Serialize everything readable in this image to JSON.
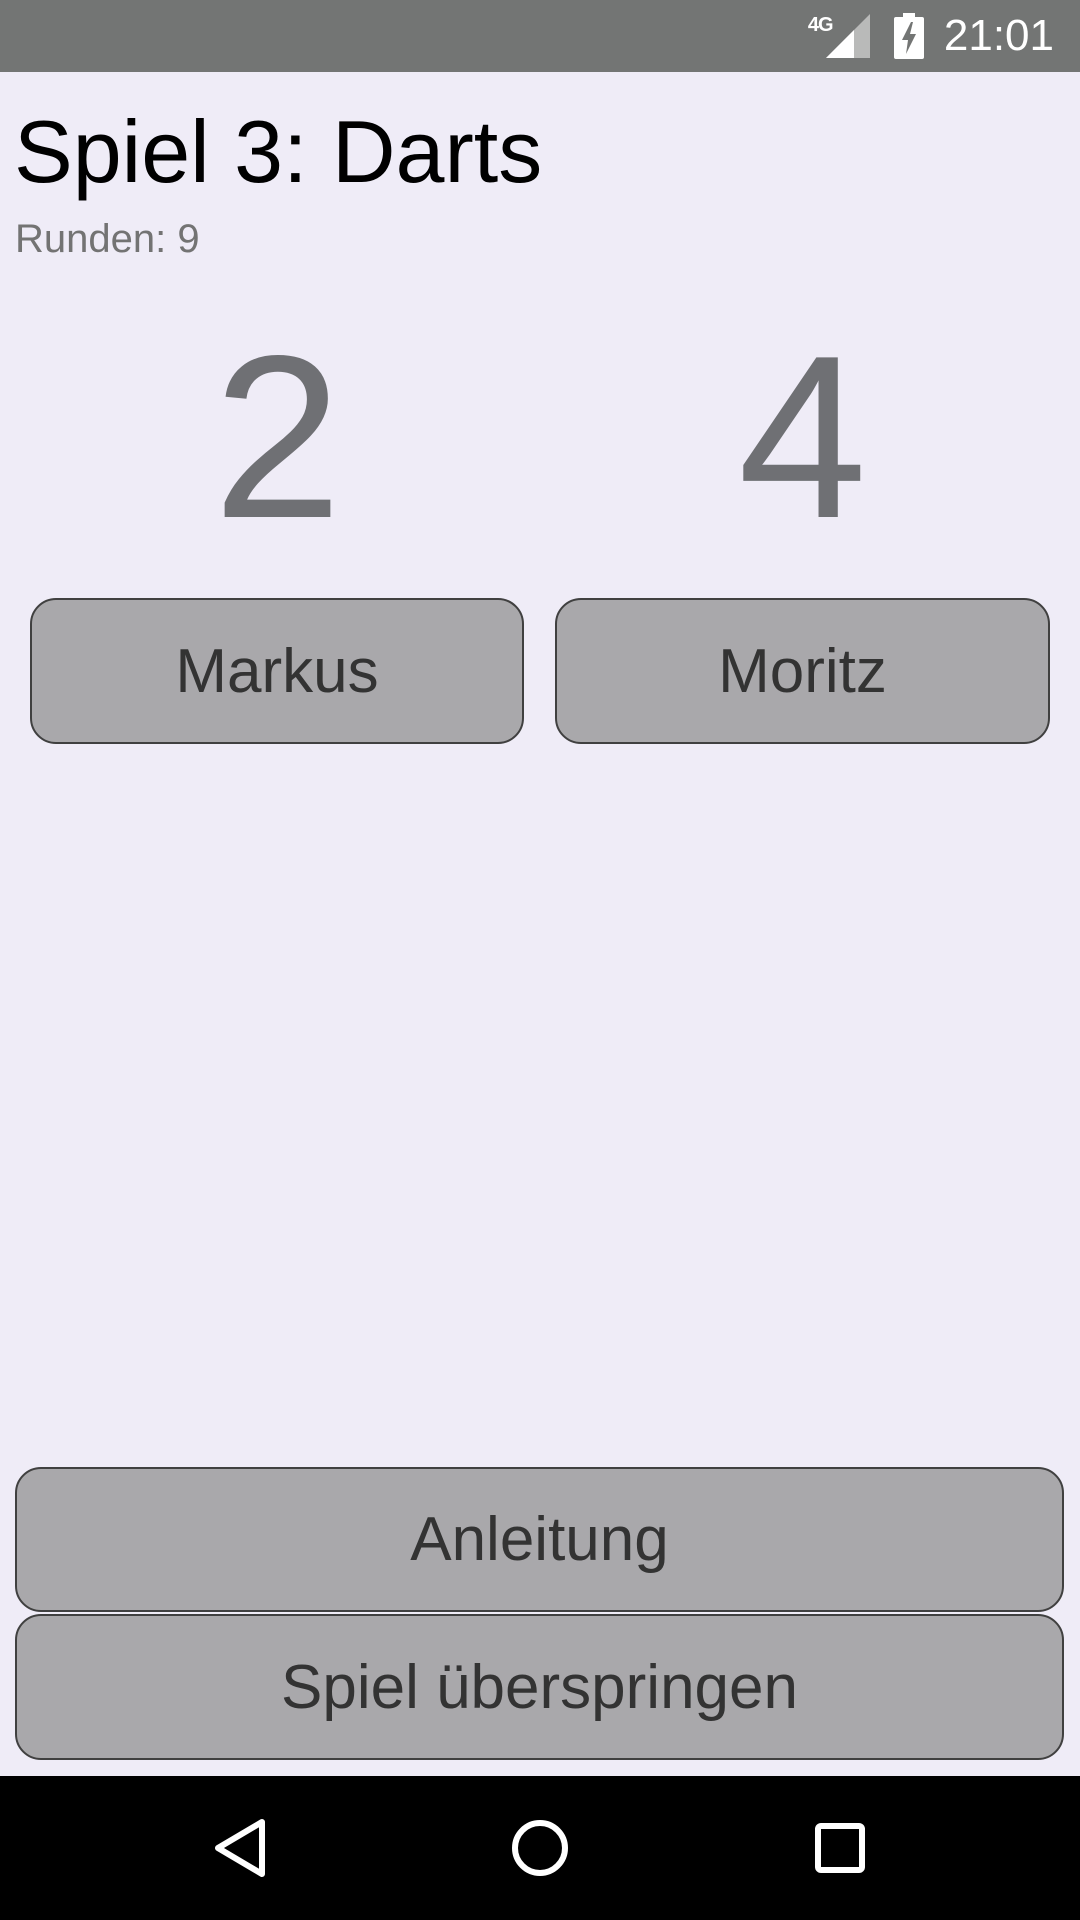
{
  "status_bar": {
    "network_label": "4G",
    "time": "21:01",
    "icons": [
      "signal-icon",
      "battery-charging-icon"
    ]
  },
  "game": {
    "title": "Spiel 3: Darts",
    "rounds_text": "Runden: 9"
  },
  "players": [
    {
      "name": "Markus",
      "score": "2"
    },
    {
      "name": "Moritz",
      "score": "4"
    }
  ],
  "actions": {
    "instructions_label": "Anleitung",
    "skip_label": "Spiel überspringen"
  },
  "nav_bar": {
    "icons": [
      "back-icon",
      "home-icon",
      "recent-apps-icon"
    ]
  },
  "colors": {
    "background": "#efecf7",
    "status_bar": "#737574",
    "button_fill": "#a9a8ab",
    "score_text": "#6f7074"
  }
}
